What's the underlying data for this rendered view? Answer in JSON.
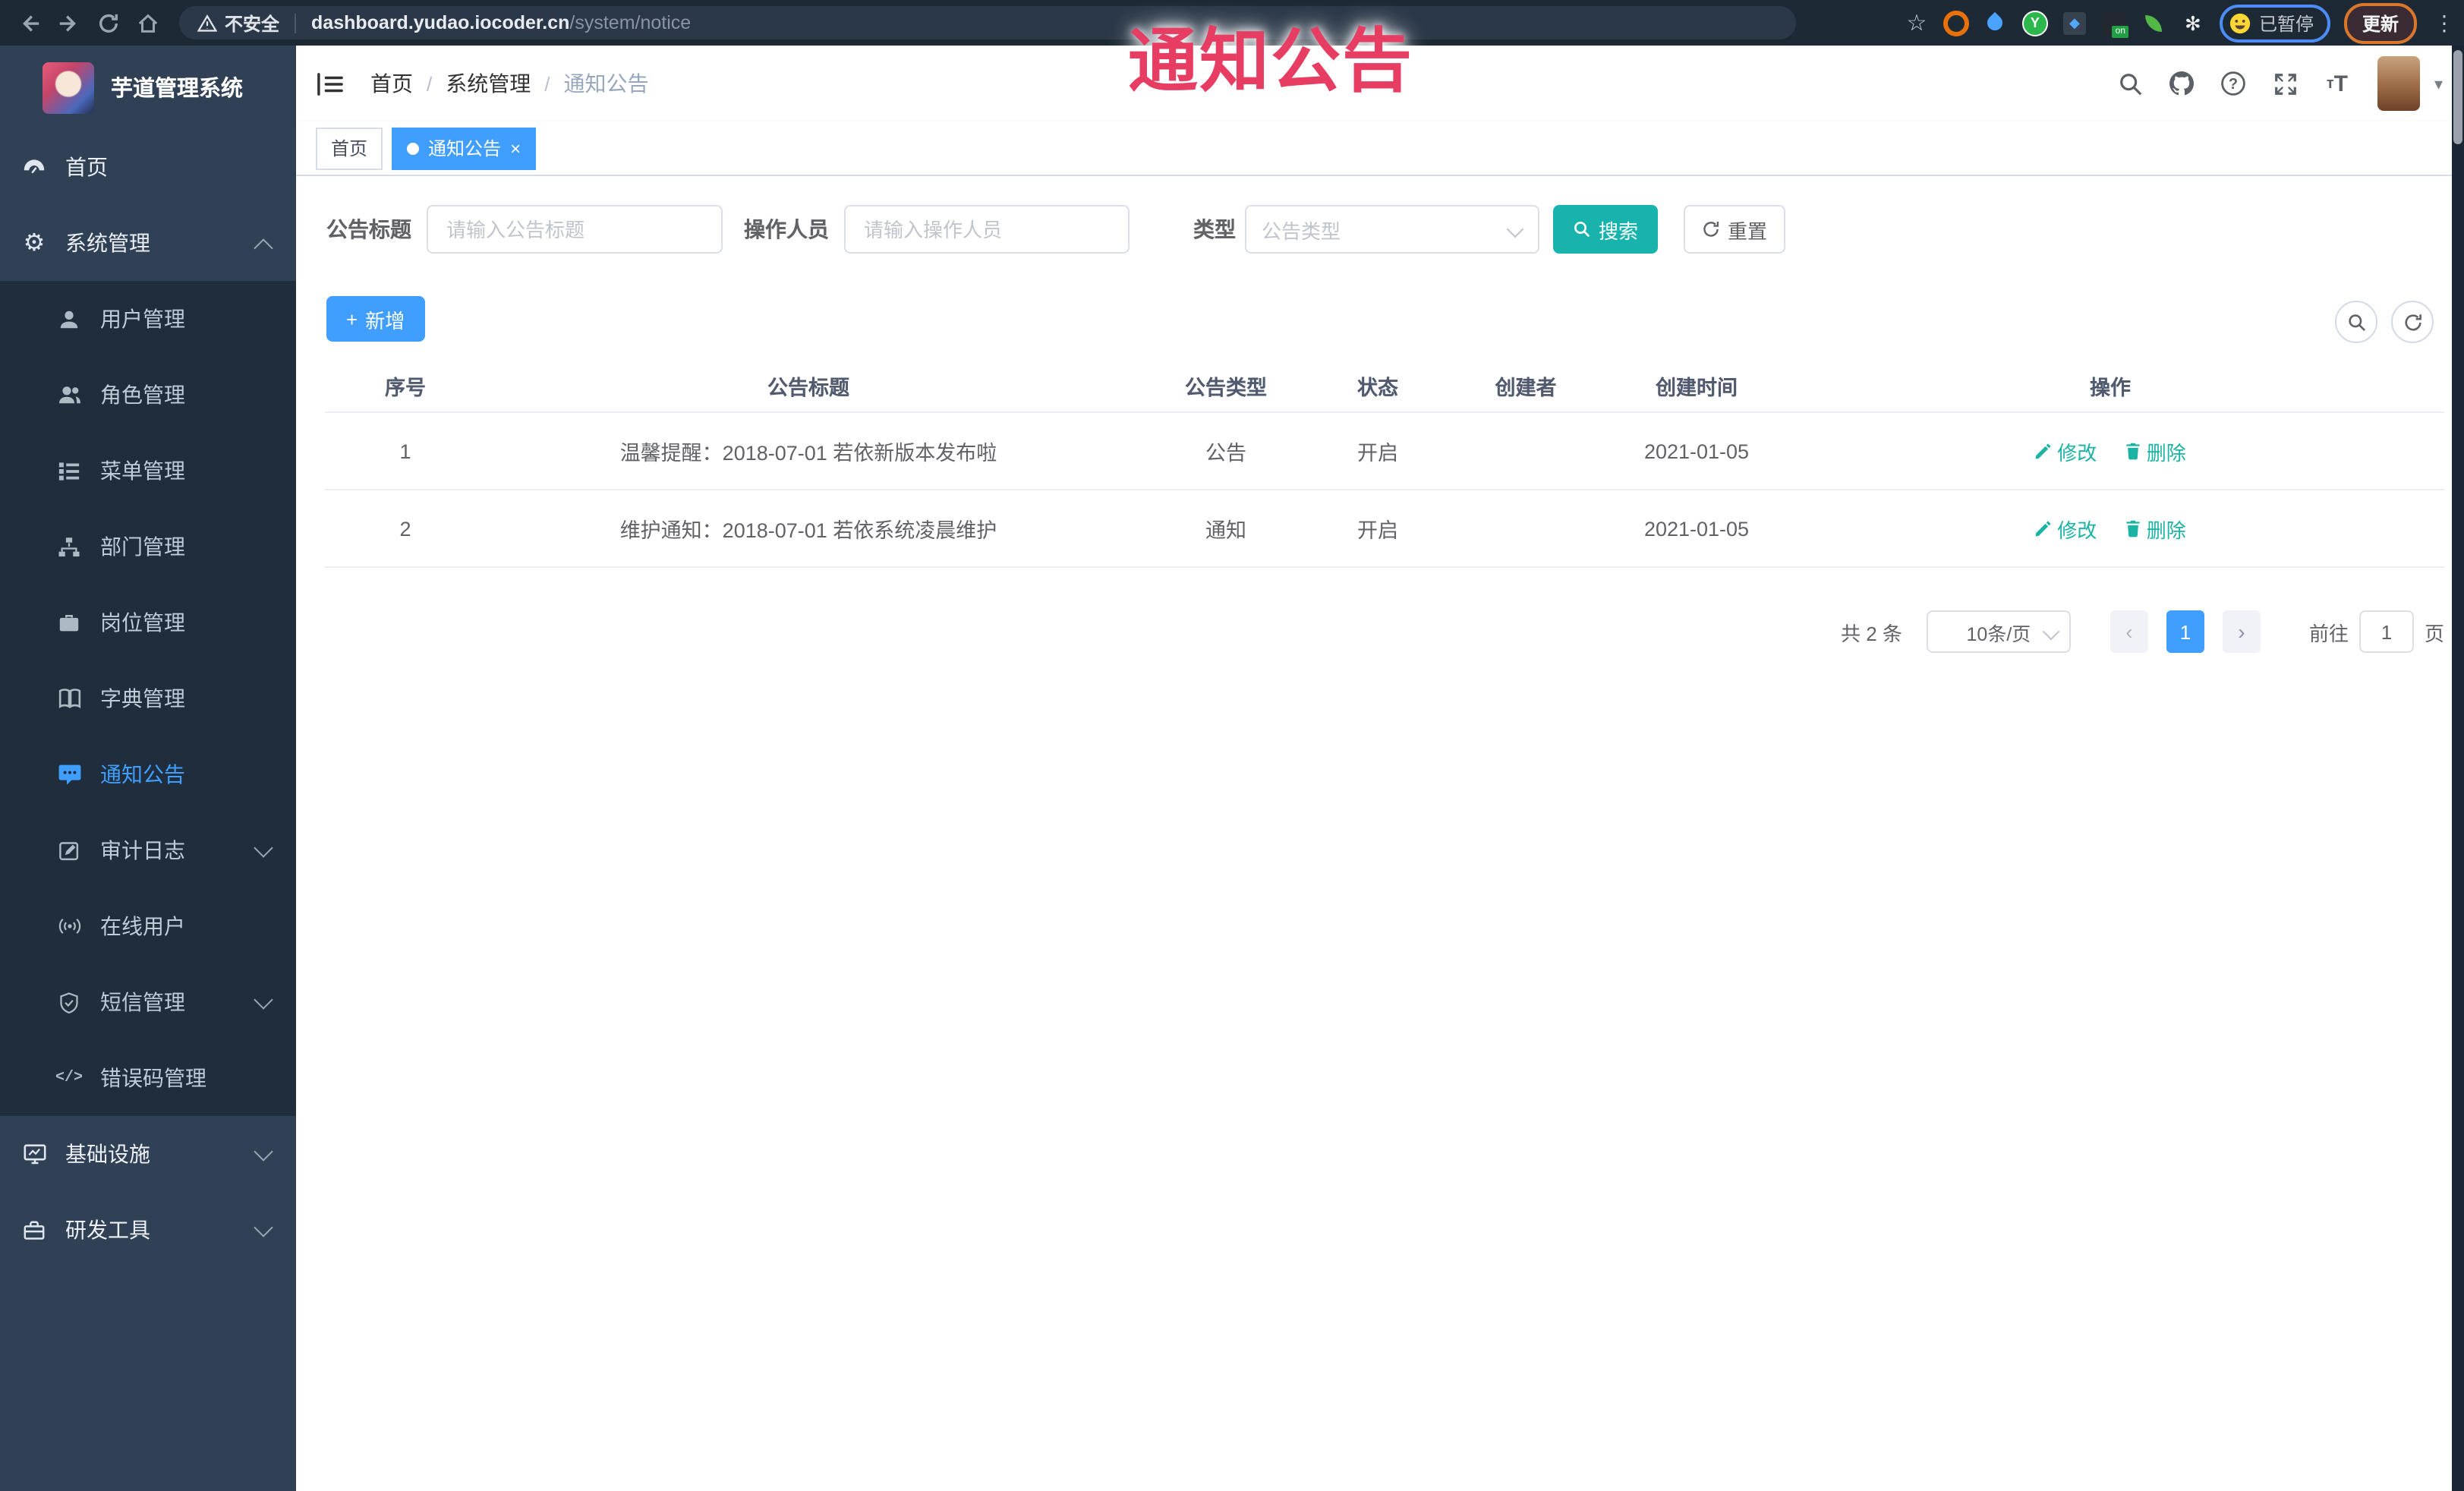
{
  "colors": {
    "primary": "#409eff",
    "teal": "#18b3ac",
    "overlay_red": "#e73d63",
    "sidebar_bg": "#304156",
    "submenu_bg": "#1f2d3d"
  },
  "overlay": {
    "title": "通知公告"
  },
  "browser": {
    "security_label": "不安全",
    "url_host": "dashboard.yudao.iocoder.cn",
    "url_path": "/system/notice",
    "paused_label": "已暂停",
    "update_label": "更新"
  },
  "sidebar": {
    "app_title": "芋道管理系统",
    "items": [
      {
        "label": "首页"
      },
      {
        "label": "系统管理"
      },
      {
        "label": "用户管理"
      },
      {
        "label": "角色管理"
      },
      {
        "label": "菜单管理"
      },
      {
        "label": "部门管理"
      },
      {
        "label": "岗位管理"
      },
      {
        "label": "字典管理"
      },
      {
        "label": "通知公告"
      },
      {
        "label": "审计日志"
      },
      {
        "label": "在线用户"
      },
      {
        "label": "短信管理"
      },
      {
        "label": "错误码管理"
      },
      {
        "label": "基础设施"
      },
      {
        "label": "研发工具"
      }
    ]
  },
  "breadcrumb": {
    "items": [
      "首页",
      "系统管理",
      "通知公告"
    ],
    "separator": "/"
  },
  "tabs": [
    {
      "label": "首页"
    },
    {
      "label": "通知公告",
      "close": "×"
    }
  ],
  "filters": {
    "title_label": "公告标题",
    "title_placeholder": "请输入公告标题",
    "operator_label": "操作人员",
    "operator_placeholder": "请输入操作人员",
    "type_label": "类型",
    "type_placeholder": "公告类型",
    "search_label": "搜索",
    "reset_label": "重置"
  },
  "toolbar": {
    "add_label": "新增"
  },
  "table": {
    "headers": [
      "序号",
      "公告标题",
      "公告类型",
      "状态",
      "创建者",
      "创建时间",
      "操作"
    ],
    "edit_label": "修改",
    "delete_label": "删除",
    "rows": [
      {
        "index": "1",
        "title": "温馨提醒：2018-07-01 若依新版本发布啦",
        "type": "公告",
        "status": "开启",
        "creator": "",
        "create_time": "2021-01-05"
      },
      {
        "index": "2",
        "title": "维护通知：2018-07-01 若依系统凌晨维护",
        "type": "通知",
        "status": "开启",
        "creator": "",
        "create_time": "2021-01-05"
      }
    ]
  },
  "pagination": {
    "total_label": "共 2 条",
    "page_size": "10条/页",
    "prev": "‹",
    "next": "›",
    "current_page": "1",
    "goto_label": "前往",
    "goto_value": "1",
    "page_unit": "页"
  }
}
